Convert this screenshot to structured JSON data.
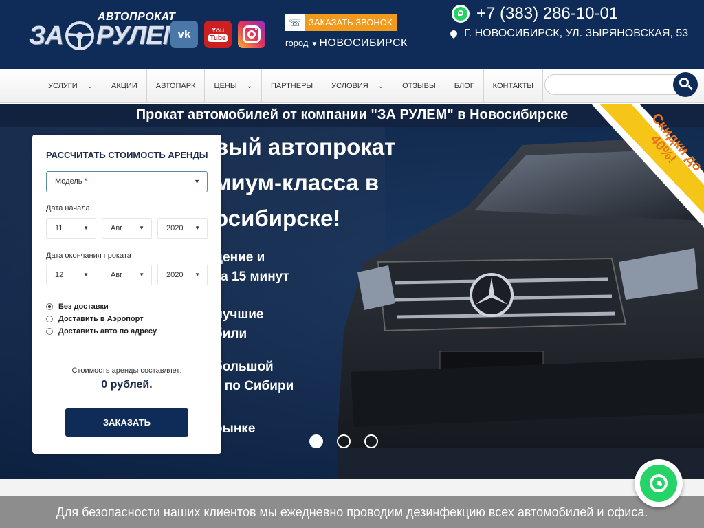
{
  "header": {
    "logo_top": "АВТОПРОКАТ",
    "logo_left": "ЗА",
    "logo_right": "РУЛЕМ",
    "social": {
      "vk": "vk",
      "youtube_top": "You",
      "youtube_bottom": "Tube"
    },
    "callback_label": "ЗАКАЗАТЬ ЗВОНОК",
    "city_word": "город",
    "city_name": "НОВОСИБИРСК",
    "phone": "+7 (383) 286-10-01",
    "address": "Г. НОВОСИБИРСК, УЛ. ЗЫРЯНОВСКАЯ, 53"
  },
  "nav": {
    "items": [
      {
        "label": "УСЛУГИ",
        "has_dropdown": true
      },
      {
        "label": "АКЦИИ",
        "has_dropdown": false
      },
      {
        "label": "АВТОПАРК",
        "has_dropdown": false
      },
      {
        "label": "ЦЕНЫ",
        "has_dropdown": true
      },
      {
        "label": "ПАРТНЕРЫ",
        "has_dropdown": false
      },
      {
        "label": "УСЛОВИЯ",
        "has_dropdown": true
      },
      {
        "label": "ОТЗЫВЫ",
        "has_dropdown": false
      },
      {
        "label": "БЛОГ",
        "has_dropdown": false
      },
      {
        "label": "КОНТАКТЫ",
        "has_dropdown": false
      }
    ],
    "search_placeholder": ""
  },
  "hero": {
    "title": "Прокат автомобилей от компании \"ЗА РУЛЕМ\" в Новосибирске",
    "slide_lines": [
      "вый автопрокат",
      "миум-класса в",
      "осибирске!",
      "дение и",
      "за 15 минут",
      "лучшие",
      "били",
      "большой",
      "к по Сибири",
      "рынке"
    ],
    "ribbon_line1": "Скидки до",
    "ribbon_line2": "40%!",
    "slides_count": 3,
    "active_slide": 1
  },
  "calculator": {
    "title": "РАССЧИТАТЬ СТОИМОСТЬ АРЕНДЫ",
    "model_label": "Модель",
    "model_required": "*",
    "start_label": "Дата начала",
    "start": {
      "day": "11",
      "month": "Авг",
      "year": "2020"
    },
    "end_label": "Дата окончания проката",
    "end": {
      "day": "12",
      "month": "Авг",
      "year": "2020"
    },
    "delivery_options": [
      {
        "label": "Без доставки",
        "selected": true
      },
      {
        "label": "Доставить в Аэропорт",
        "selected": false
      },
      {
        "label": "Доставить авто по адресу",
        "selected": false
      }
    ],
    "cost_label": "Стоимость аренды составляет:",
    "cost_value": "0 рублей.",
    "order_label": "ЗАКАЗАТЬ"
  },
  "notice": "Для безопасности наших клиентов мы ежедневно проводим дезинфекцию всех автомобилей и офиса.",
  "colors": {
    "brand_navy": "#0e2c57",
    "accent_orange": "#f29a1c",
    "ribbon_yellow": "#f5c518",
    "whatsapp_green": "#25d366",
    "notice_gray": "#8d8d8d"
  }
}
